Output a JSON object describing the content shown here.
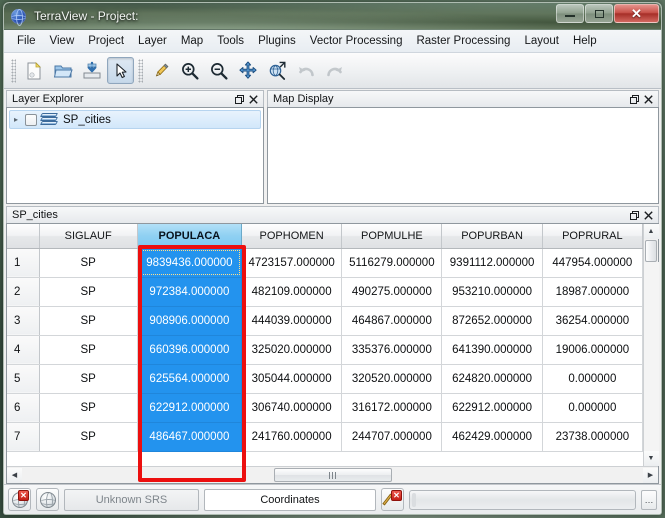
{
  "window": {
    "title": "TerraView - Project:",
    "app_icon": "globe-icon",
    "minimize_label": "–",
    "maximize_label": "□",
    "close_label": "✕"
  },
  "menubar": {
    "items": [
      {
        "label": "File"
      },
      {
        "label": "View"
      },
      {
        "label": "Project"
      },
      {
        "label": "Layer"
      },
      {
        "label": "Map"
      },
      {
        "label": "Tools"
      },
      {
        "label": "Plugins"
      },
      {
        "label": "Vector Processing"
      },
      {
        "label": "Raster Processing"
      },
      {
        "label": "Layout"
      },
      {
        "label": "Help"
      }
    ]
  },
  "toolbar": {
    "buttons": [
      {
        "name": "new-project-icon",
        "state": "enabled"
      },
      {
        "name": "open-project-icon",
        "state": "enabled"
      },
      {
        "name": "save-project-icon",
        "state": "enabled"
      },
      {
        "name": "pointer-select-icon",
        "state": "checked"
      },
      {
        "name": "draw-pencil-icon",
        "state": "enabled"
      },
      {
        "name": "zoom-in-icon",
        "state": "enabled"
      },
      {
        "name": "zoom-out-icon",
        "state": "enabled"
      },
      {
        "name": "pan-icon",
        "state": "enabled"
      },
      {
        "name": "zoom-extent-icon",
        "state": "enabled"
      },
      {
        "name": "undo-icon",
        "state": "disabled"
      },
      {
        "name": "redo-icon",
        "state": "disabled"
      }
    ]
  },
  "panels": {
    "layer_explorer": {
      "title": "Layer Explorer",
      "float_label": "❐",
      "close_label": "✕",
      "tree": [
        {
          "label": "SP_cities",
          "checked": false,
          "expanded": false,
          "selected": true
        }
      ]
    },
    "map_display": {
      "title": "Map Display",
      "float_label": "❐",
      "close_label": "✕"
    }
  },
  "table_dock": {
    "title": "SP_cities",
    "float_label": "❐",
    "close_label": "✕"
  },
  "table": {
    "selected_column": "POPULACA",
    "headers": [
      "",
      "SIGLAUF",
      "POPULACA",
      "POPHOMEN",
      "POPMULHE",
      "POPURBAN",
      "POPRURAL"
    ],
    "rows": [
      {
        "num": "1",
        "SIGLAUF": "SP",
        "POPULACA": "9839436.000000",
        "POPHOMEN": "4723157.000000",
        "POPMULHE": "5116279.000000",
        "POPURBAN": "9391112.000000",
        "POPRURAL": "447954.000000"
      },
      {
        "num": "2",
        "SIGLAUF": "SP",
        "POPULACA": "972384.000000",
        "POPHOMEN": "482109.000000",
        "POPMULHE": "490275.000000",
        "POPURBAN": "953210.000000",
        "POPRURAL": "18987.000000"
      },
      {
        "num": "3",
        "SIGLAUF": "SP",
        "POPULACA": "908906.000000",
        "POPHOMEN": "444039.000000",
        "POPMULHE": "464867.000000",
        "POPURBAN": "872652.000000",
        "POPRURAL": "36254.000000"
      },
      {
        "num": "4",
        "SIGLAUF": "SP",
        "POPULACA": "660396.000000",
        "POPHOMEN": "325020.000000",
        "POPMULHE": "335376.000000",
        "POPURBAN": "641390.000000",
        "POPRURAL": "19006.000000"
      },
      {
        "num": "5",
        "SIGLAUF": "SP",
        "POPULACA": "625564.000000",
        "POPHOMEN": "305044.000000",
        "POPMULHE": "320520.000000",
        "POPURBAN": "624820.000000",
        "POPRURAL": "0.000000"
      },
      {
        "num": "6",
        "SIGLAUF": "SP",
        "POPULACA": "622912.000000",
        "POPHOMEN": "306740.000000",
        "POPMULHE": "316172.000000",
        "POPURBAN": "622912.000000",
        "POPRURAL": "0.000000"
      },
      {
        "num": "7",
        "SIGLAUF": "SP",
        "POPULACA": "486467.000000",
        "POPHOMEN": "241760.000000",
        "POPMULHE": "244707.000000",
        "POPURBAN": "462429.000000",
        "POPRURAL": "23738.000000"
      }
    ]
  },
  "scrollbars": {
    "up_arrow": "▲",
    "down_arrow": "▼",
    "left_arrow": "◀",
    "right_arrow": "▶"
  },
  "statusbar": {
    "srs_label": "Unknown SRS",
    "coordinates_label": "Coordinates",
    "more_label": "…",
    "badge_label": "✕"
  },
  "colors": {
    "selection_blue": "#2393ee",
    "header_selected_blue": "#8fd0f2",
    "annotation_red": "#ec0f0f",
    "titlebar_green": "#44573f"
  }
}
